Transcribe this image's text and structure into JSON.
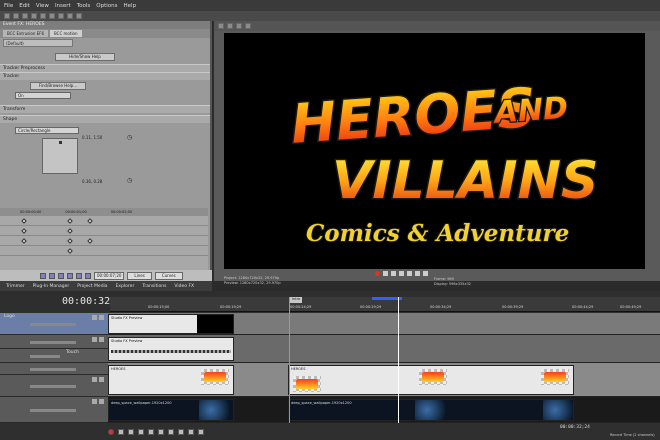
{
  "menu": [
    "File",
    "Edit",
    "View",
    "Insert",
    "Tools",
    "Options",
    "Help"
  ],
  "fx": {
    "title": "Event FX: HEROES",
    "tabs": [
      "BCC Extrusion EF6",
      "BCC motion"
    ],
    "preset": "(Default)",
    "hide_button": "Hide/Show Help",
    "sections": [
      "Tracker Preprocess",
      "Tracker",
      "Transform",
      "Shape"
    ],
    "find_button": "Find/Browse Help...",
    "mode_value": "On",
    "shape_value": "Circle/Rectangle",
    "coord1": "0.11, 1.50",
    "coord2": "0.36, 0.28",
    "kf_ticks": [
      "00:00:00;00",
      "00:00:01;00",
      "00:00:02;00"
    ],
    "kf_timecode": "00:00:07;20",
    "kf_tabs": [
      "Lines",
      "Curves"
    ]
  },
  "preview": {
    "headline1": "HEROES",
    "headline2": "AND",
    "headline3": "VILLAINS",
    "subhead": "Comics & Adventure",
    "project_line": "Project: 1280x720x32, 29.970p",
    "preview_line": "Preview: 1280x720x32, 29.970p",
    "display_line": "Display: 596x335x32",
    "frame_line": "Frame: 969"
  },
  "window_tabs": [
    "Trimmer",
    "Plug-In Manager",
    "Project Media",
    "Explorer",
    "Transitions",
    "Video FX"
  ],
  "timeline": {
    "timecode": "00:00:32;24",
    "ruler_ticks": [
      "00:00:15;00",
      "00:00:19;29",
      "00:00:24;29",
      "00:00:29;29",
      "00:00:34;29",
      "00:00:39;29",
      "00:00:44;29",
      "00:00:49;29"
    ],
    "marker_label": "Intro",
    "tracks": [
      "Logo",
      "",
      "Touch",
      "",
      "HEROES",
      "space"
    ],
    "clips": {
      "solid1": "Studio FX Preview",
      "solid2": "Studio FX Preview",
      "heroes1": "HEROES",
      "heroes2": "HEROES",
      "space1": "deep_space_wallpaper-1920x1200",
      "space2": "deep_space_wallpaper-1920x1200"
    }
  },
  "bottom": {
    "time": "00:00:32;24",
    "record_time": "Record Time (2 channels)"
  },
  "colors": {
    "accent_blue": "#2c62ff",
    "record_red": "#e03020",
    "logo_red": "#ff3b1f",
    "logo_yellow": "#ffd21f"
  }
}
